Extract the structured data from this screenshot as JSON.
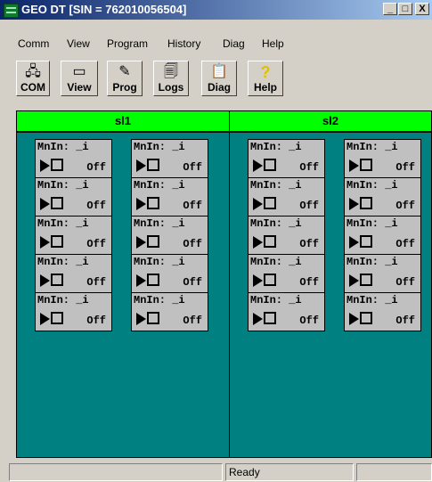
{
  "window": {
    "title": "GEO DT [SIN = 762010056504]",
    "min_glyph": "_",
    "max_glyph": "□",
    "close_glyph": "X"
  },
  "menu": [
    {
      "label": "Comm"
    },
    {
      "label": "View"
    },
    {
      "label": "Program"
    },
    {
      "label": "History"
    },
    {
      "label": "Diag"
    },
    {
      "label": "Help"
    }
  ],
  "toolbar": [
    {
      "label": "COM",
      "icon": "com-icon",
      "glyph": "🖧"
    },
    {
      "label": "View",
      "icon": "view-icon",
      "glyph": "▭"
    },
    {
      "label": "Prog",
      "icon": "prog-icon",
      "glyph": "✎"
    },
    {
      "label": "Logs",
      "icon": "logs-icon",
      "glyph": "🗐"
    },
    {
      "label": "Diag",
      "icon": "diag-icon",
      "glyph": "📋"
    },
    {
      "label": "Help",
      "icon": "help-icon",
      "glyph": "?"
    }
  ],
  "slots": [
    {
      "label": "sl1",
      "cells": [
        {
          "name": "MnIn: _i",
          "state": "Off"
        },
        {
          "name": "MnIn: _i",
          "state": "Off"
        },
        {
          "name": "MnIn: _i",
          "state": "Off"
        },
        {
          "name": "MnIn: _i",
          "state": "Off"
        },
        {
          "name": "MnIn: _i",
          "state": "Off"
        },
        {
          "name": "MnIn: _i",
          "state": "Off"
        },
        {
          "name": "MnIn: _i",
          "state": "Off"
        },
        {
          "name": "MnIn: _i",
          "state": "Off"
        },
        {
          "name": "MnIn: _i",
          "state": "Off"
        },
        {
          "name": "MnIn: _i",
          "state": "Off"
        }
      ]
    },
    {
      "label": "sl2",
      "cells": [
        {
          "name": "MnIn: _i",
          "state": "Off"
        },
        {
          "name": "MnIn: _i",
          "state": "Off"
        },
        {
          "name": "MnIn: _i",
          "state": "Off"
        },
        {
          "name": "MnIn: _i",
          "state": "Off"
        },
        {
          "name": "MnIn: _i",
          "state": "Off"
        },
        {
          "name": "MnIn: _i",
          "state": "Off"
        },
        {
          "name": "MnIn: _i",
          "state": "Off"
        },
        {
          "name": "MnIn: _i",
          "state": "Off"
        },
        {
          "name": "MnIn: _i",
          "state": "Off"
        },
        {
          "name": "MnIn: _i",
          "state": "Off"
        }
      ]
    }
  ],
  "status": {
    "left": "",
    "middle": "Ready",
    "right": ""
  },
  "colors": {
    "slot_header": "#00ff00",
    "slot_body": "#008080",
    "cell_bg": "#c0c0c0",
    "title_bar": "#0a246a"
  }
}
